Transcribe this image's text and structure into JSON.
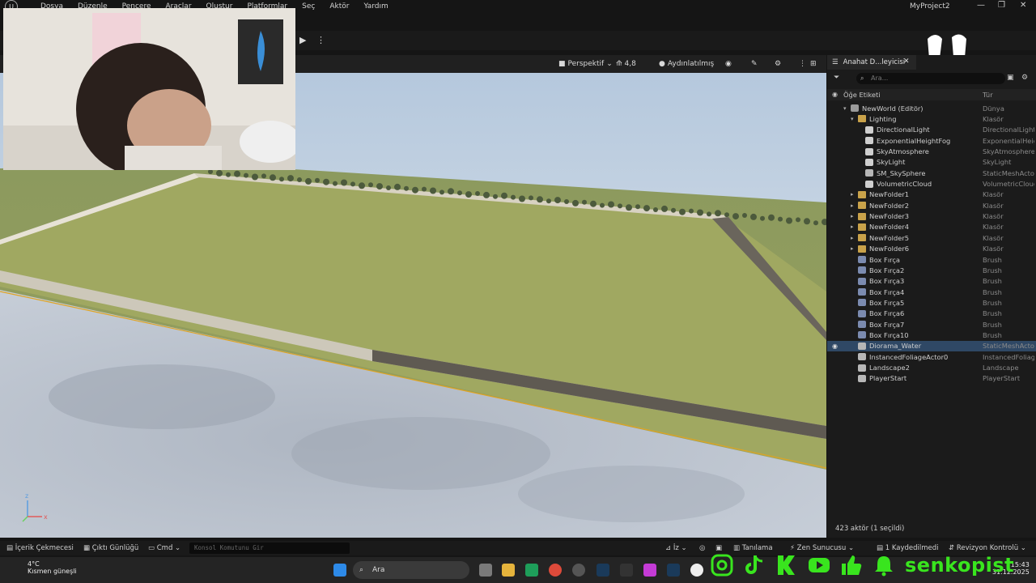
{
  "app": {
    "project_title": "MyProject2",
    "window_controls": {
      "minimize": "—",
      "maximize": "❐",
      "close": "✕"
    }
  },
  "menu": [
    "Dosya",
    "Düzenle",
    "Pencere",
    "Araçlar",
    "Oluştur",
    "Platformlar",
    "Seç",
    "Aktör",
    "Yardım"
  ],
  "viewport": {
    "perspective_label": "Perspektif",
    "speed_label": "4,8",
    "lighting_label": "Aydınlatılmış",
    "axis_x": "x",
    "axis_z": "z"
  },
  "outliner": {
    "tab_label": "Anahat D...leyicisi",
    "search_placeholder": "Ara...",
    "col_label": "Öğe Etiketi",
    "col_type": "Tür",
    "rows": [
      {
        "name": "NewWorld (Editör)",
        "type": "Dünya",
        "icon": "world-icon",
        "depth": 1
      },
      {
        "name": "Lighting",
        "type": "Klasör",
        "icon": "folder-open-icon",
        "depth": 2
      },
      {
        "name": "DirectionalLight",
        "type": "DirectionalLight",
        "icon": "sun-icon",
        "depth": 3
      },
      {
        "name": "ExponentialHeightFog",
        "type": "ExponentialHeig",
        "icon": "fog-icon",
        "depth": 3
      },
      {
        "name": "SkyAtmosphere",
        "type": "SkyAtmosphere",
        "icon": "sky-icon",
        "depth": 3
      },
      {
        "name": "SkyLight",
        "type": "SkyLight",
        "icon": "skylight-icon",
        "depth": 3
      },
      {
        "name": "SM_SkySphere",
        "type": "StaticMeshActor",
        "icon": "mesh-icon",
        "depth": 3
      },
      {
        "name": "VolumetricCloud",
        "type": "VolumetricCloud",
        "icon": "cloud-icon",
        "depth": 3
      },
      {
        "name": "NewFolder1",
        "type": "Klasör",
        "icon": "folder-icon",
        "depth": 2
      },
      {
        "name": "NewFolder2",
        "type": "Klasör",
        "icon": "folder-icon",
        "depth": 2
      },
      {
        "name": "NewFolder3",
        "type": "Klasör",
        "icon": "folder-icon",
        "depth": 2
      },
      {
        "name": "NewFolder4",
        "type": "Klasör",
        "icon": "folder-icon",
        "depth": 2
      },
      {
        "name": "NewFolder5",
        "type": "Klasör",
        "icon": "folder-icon",
        "depth": 2
      },
      {
        "name": "NewFolder6",
        "type": "Klasör",
        "icon": "folder-icon",
        "depth": 2
      },
      {
        "name": "Box Fırça",
        "type": "Brush",
        "icon": "brush-icon",
        "depth": 2
      },
      {
        "name": "Box Fırça2",
        "type": "Brush",
        "icon": "brush-icon",
        "depth": 2
      },
      {
        "name": "Box Fırça3",
        "type": "Brush",
        "icon": "brush-icon",
        "depth": 2
      },
      {
        "name": "Box Fırça4",
        "type": "Brush",
        "icon": "brush-icon",
        "depth": 2
      },
      {
        "name": "Box Fırça5",
        "type": "Brush",
        "icon": "brush-icon",
        "depth": 2
      },
      {
        "name": "Box Fırça6",
        "type": "Brush",
        "icon": "brush-icon",
        "depth": 2
      },
      {
        "name": "Box Fırça7",
        "type": "Brush",
        "icon": "brush-icon",
        "depth": 2
      },
      {
        "name": "Box Fırça10",
        "type": "Brush",
        "icon": "brush-icon",
        "depth": 2
      },
      {
        "name": "Diorama_Water",
        "type": "StaticMeshActor",
        "icon": "mesh-icon",
        "depth": 2,
        "selected": true
      },
      {
        "name": "InstancedFoliageActor0",
        "type": "InstancedFoliage",
        "icon": "foliage-icon",
        "depth": 2
      },
      {
        "name": "Landscape2",
        "type": "Landscape",
        "icon": "landscape-icon",
        "depth": 2
      },
      {
        "name": "PlayerStart",
        "type": "PlayerStart",
        "icon": "flag-icon",
        "depth": 2
      }
    ],
    "footer": "423 aktör (1 seçildi)"
  },
  "bottom_bar": {
    "content_drawer": "İçerik Çekmecesi",
    "output_log": "Çıktı Günlüğü",
    "cmd": "Cmd",
    "console_placeholder": "Konsol Komutunu Gir",
    "trace": "İz",
    "diagnostics": "Tanılama",
    "zen": "Zen Sunucusu",
    "unsaved": "1 Kaydedilmedi",
    "revision": "Revizyon Kontrolü"
  },
  "taskbar": {
    "temperature": "4°C",
    "weather": "Kısmen güneşli",
    "search": "Ara",
    "time": "15:43",
    "date": "31.12.2025"
  },
  "overlay": {
    "handle": "senkopist",
    "accent": "#39e51e"
  },
  "colors": {
    "selection": "#2f4865",
    "viewport_border": "#e0a422"
  }
}
